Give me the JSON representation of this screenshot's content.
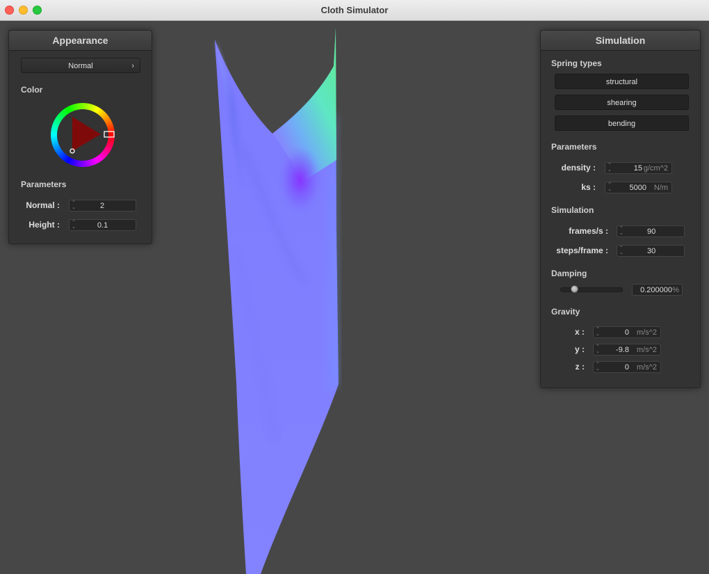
{
  "window": {
    "title": "Cloth Simulator"
  },
  "appearance": {
    "title": "Appearance",
    "shader": "Normal",
    "color_label": "Color",
    "params_label": "Parameters",
    "normal": {
      "label": "Normal :",
      "value": "2"
    },
    "height": {
      "label": "Height :",
      "value": "0.1"
    },
    "colors": {
      "selected": "#e1191e"
    }
  },
  "simulation": {
    "title": "Simulation",
    "spring_types_label": "Spring types",
    "springs": [
      "structural",
      "shearing",
      "bending"
    ],
    "params_label": "Parameters",
    "density": {
      "label": "density :",
      "value": "15",
      "unit": "g/cm^2"
    },
    "ks": {
      "label": "ks :",
      "value": "5000",
      "unit": "N/m"
    },
    "sim_label": "Simulation",
    "fps": {
      "label": "frames/s :",
      "value": "90"
    },
    "steps": {
      "label": "steps/frame :",
      "value": "30"
    },
    "damping_label": "Damping",
    "damping": {
      "value": "0.200000",
      "unit": "%",
      "slider_fraction": 0.2
    },
    "gravity_label": "Gravity",
    "gravity": {
      "x": {
        "label": "x :",
        "value": "0",
        "unit": "m/s^2"
      },
      "y": {
        "label": "y :",
        "value": "-9.8",
        "unit": "m/s^2"
      },
      "z": {
        "label": "z :",
        "value": "0",
        "unit": "m/s^2"
      }
    }
  },
  "colors": {
    "background": "#474747",
    "cloth": "#8080ff"
  }
}
